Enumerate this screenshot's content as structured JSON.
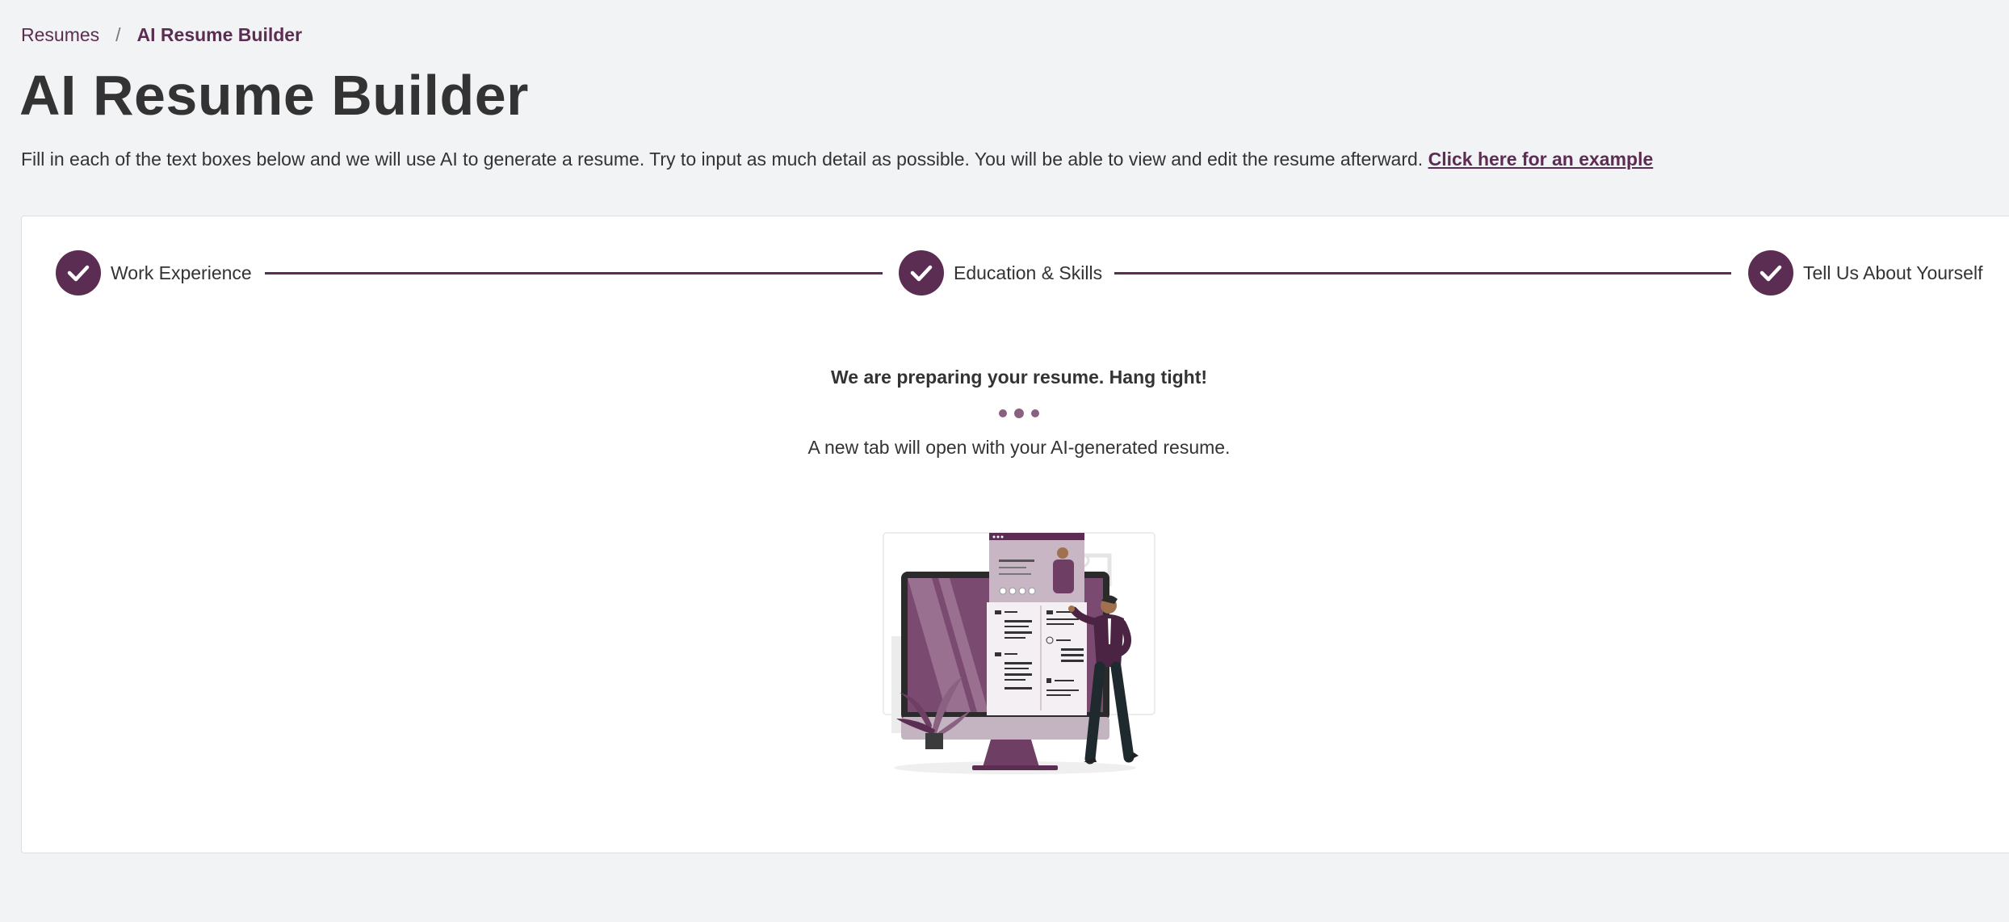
{
  "breadcrumb": {
    "parent": "Resumes",
    "separator": "/",
    "current": "AI Resume Builder"
  },
  "page_title": "AI Resume Builder",
  "intro": {
    "text": "Fill in each of the text boxes below and we will use AI to generate a resume. Try to input as much detail as possible. You will be able to view and edit the resume afterward.",
    "example_link": "Click here for an example"
  },
  "steps": [
    {
      "label": "Work Experience",
      "status": "completed",
      "icon": "check-icon"
    },
    {
      "label": "Education & Skills",
      "status": "completed",
      "icon": "check-icon"
    },
    {
      "label": "Tell Us About Yourself",
      "status": "completed",
      "icon": "check-icon"
    }
  ],
  "loading": {
    "title": "We are preparing your resume. Hang tight!",
    "subtitle": "A new tab will open with your AI-generated resume."
  },
  "colors": {
    "accent": "#5c2d52",
    "accent_light": "#8a6181",
    "background": "#f2f3f5",
    "card": "#ffffff",
    "text": "#333333"
  }
}
